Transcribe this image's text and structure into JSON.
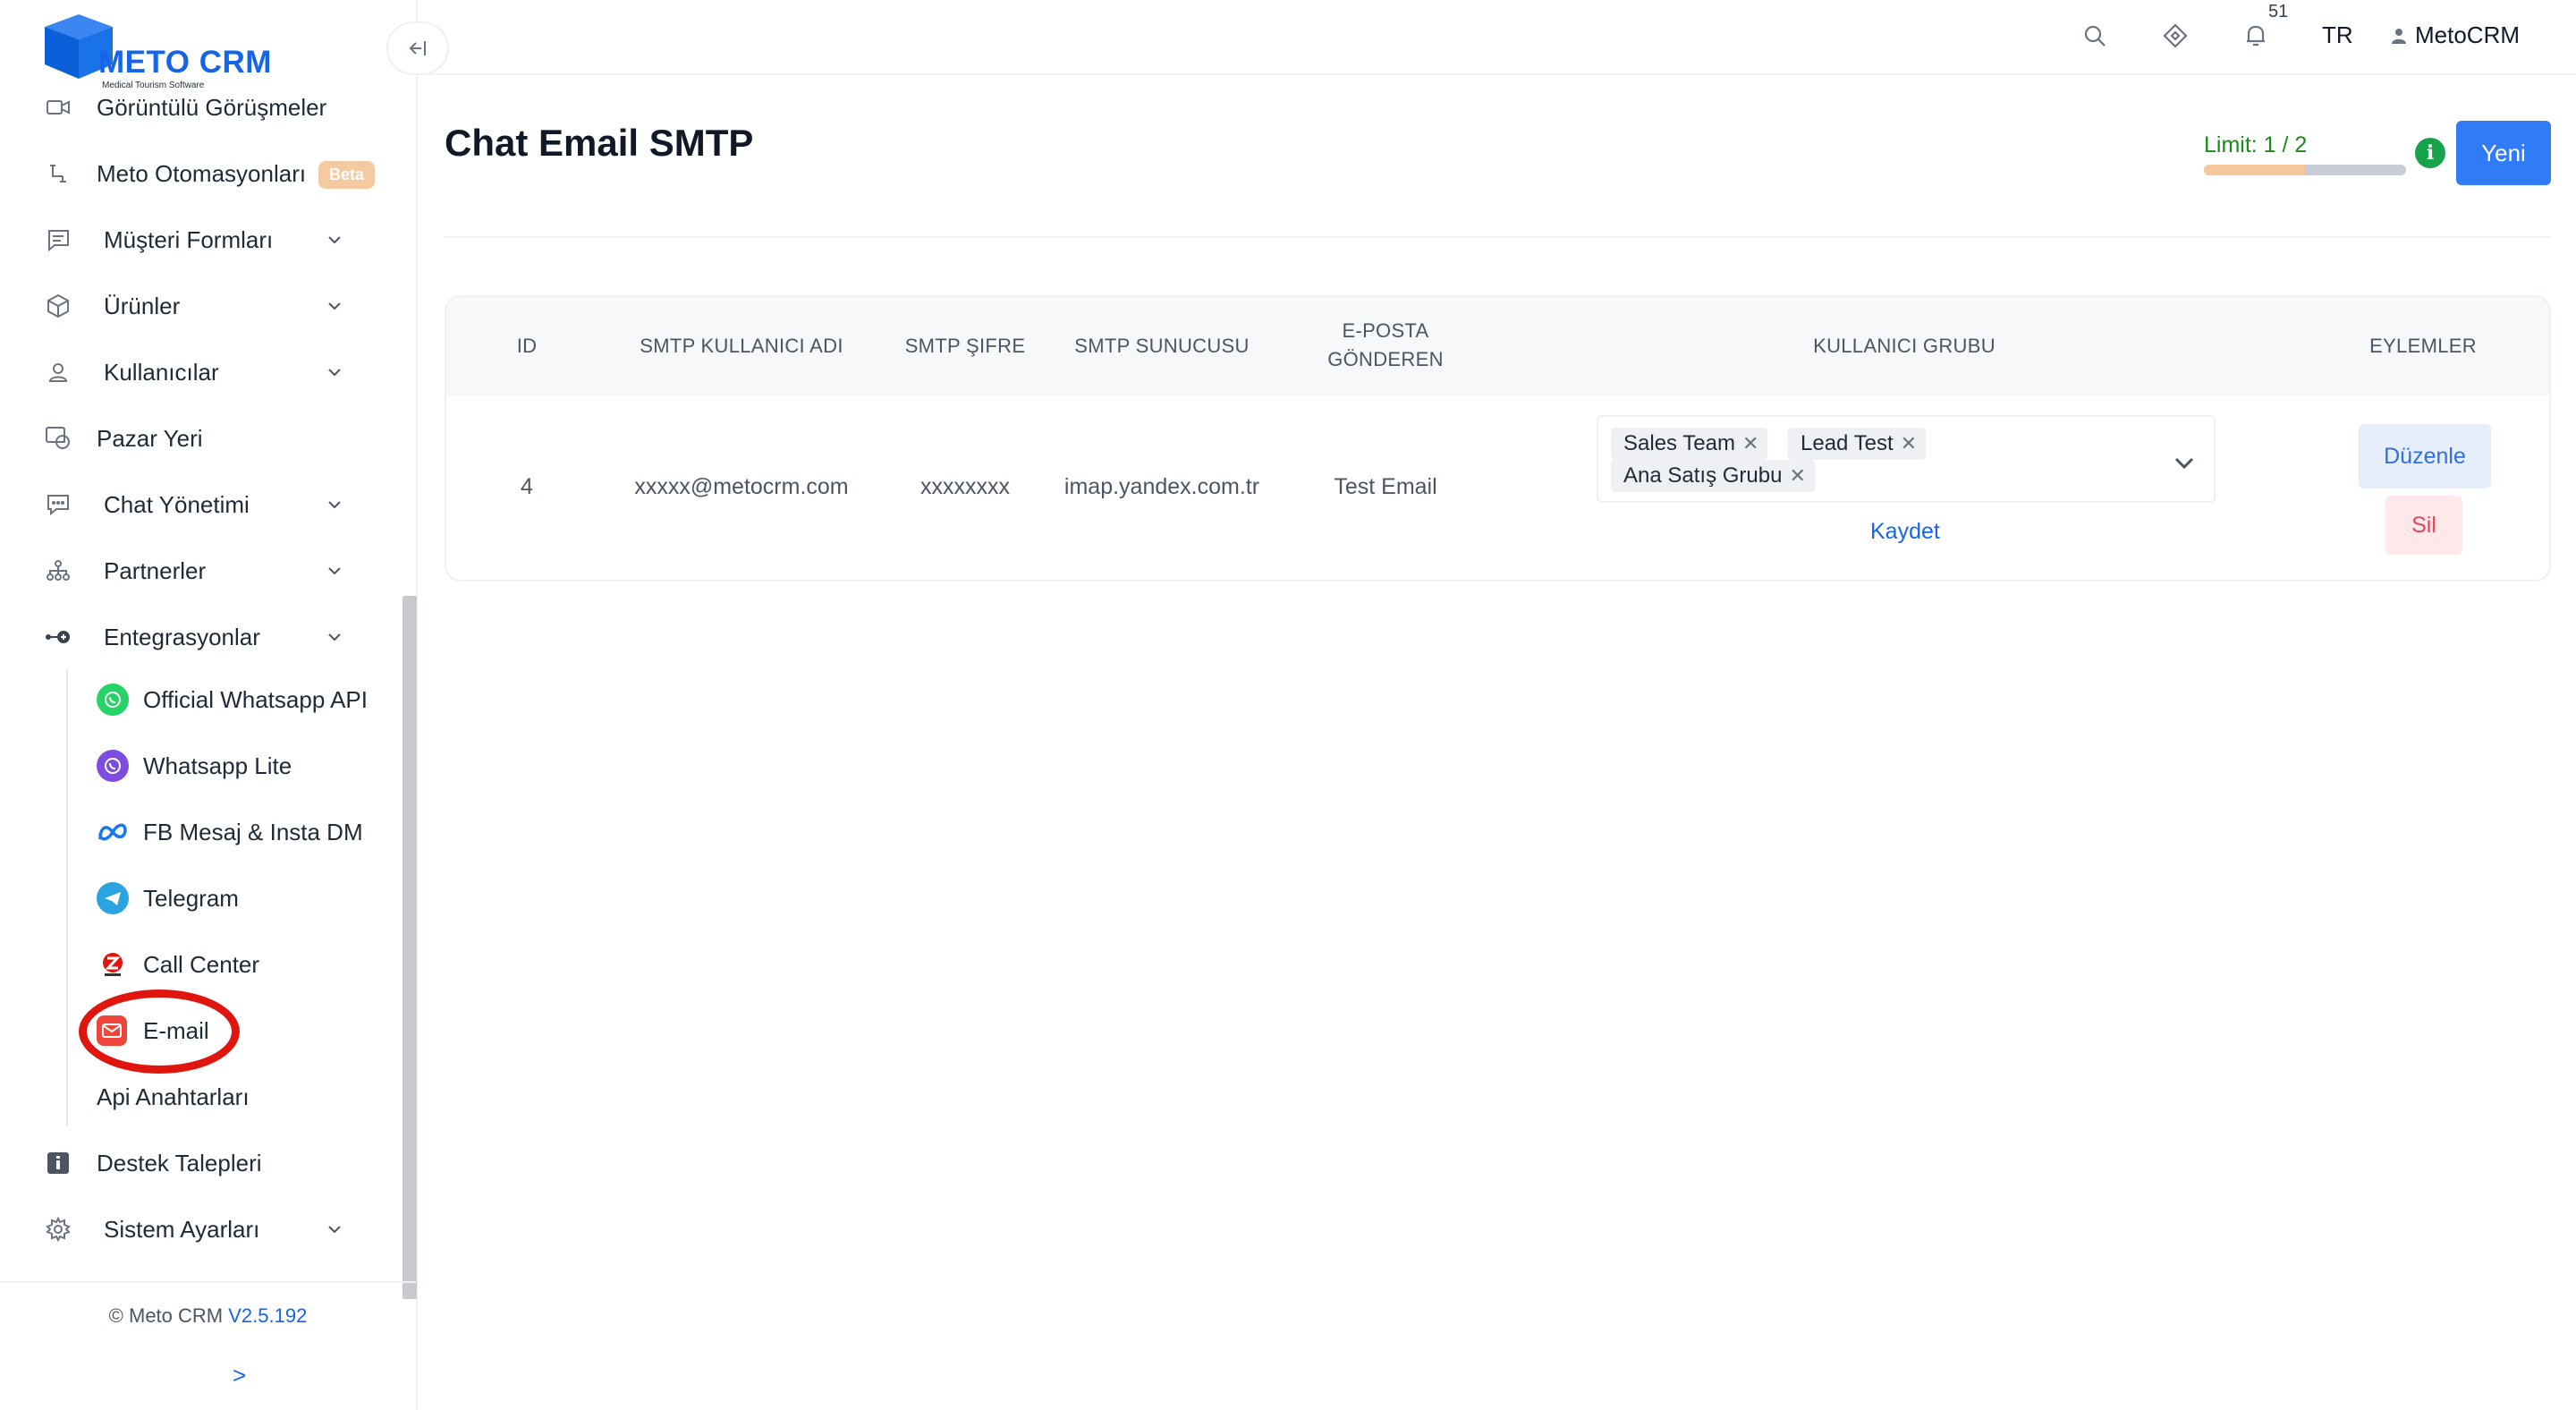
{
  "brand": {
    "name": "METO CRM",
    "tagline": "Medical Tourism Software",
    "color": "#1565e8"
  },
  "sidebar": {
    "collapse_icon": "collapse-left-icon",
    "items": [
      {
        "label": "Görüntülü Görüşmeler",
        "icon": "video-icon"
      },
      {
        "label": "Meto Otomasyonları",
        "icon": "automation-icon",
        "badge": "Beta"
      },
      {
        "label": "Müşteri Formları",
        "icon": "form-icon",
        "expandable": true
      },
      {
        "label": "Ürünler",
        "icon": "box-icon",
        "expandable": true
      },
      {
        "label": "Kullanıcılar",
        "icon": "user-icon",
        "expandable": true
      },
      {
        "label": "Pazar Yeri",
        "icon": "marketplace-icon"
      },
      {
        "label": "Chat Yönetimi",
        "icon": "chat-icon",
        "expandable": true
      },
      {
        "label": "Partnerler",
        "icon": "partners-icon",
        "expandable": true
      },
      {
        "label": "Entegrasyonlar",
        "icon": "integration-icon",
        "expandable": true,
        "expanded": true
      }
    ],
    "integrations": [
      {
        "label": "Official Whatsapp API",
        "icon": "whatsapp-icon"
      },
      {
        "label": "Whatsapp Lite",
        "icon": "viber-icon"
      },
      {
        "label": "FB Mesaj & Insta DM",
        "icon": "meta-icon"
      },
      {
        "label": "Telegram",
        "icon": "telegram-icon"
      },
      {
        "label": "Call Center",
        "icon": "zadarma-icon"
      },
      {
        "label": "E-mail",
        "icon": "mail-icon",
        "highlighted": true
      },
      {
        "label": "Api Anahtarları"
      }
    ],
    "bottom_items": [
      {
        "label": "Destek Talepleri",
        "icon": "info-square-icon"
      },
      {
        "label": "Sistem Ayarları",
        "icon": "settings-icon",
        "expandable": true
      }
    ],
    "footer": {
      "copyright": "© Meto CRM",
      "version": "V2.5.192",
      "arrow": ">"
    }
  },
  "topbar": {
    "notification_count": "51",
    "language": "TR",
    "user": "MetoCRM"
  },
  "page": {
    "title": "Chat Email SMTP",
    "limit_label": "Limit: 1 / 2",
    "limit_fraction": 0.5,
    "new_button": "Yeni"
  },
  "table": {
    "headers": {
      "id": "ID",
      "user": "SMTP KULLANICI ADI",
      "password": "SMTP ŞIFRE",
      "server": "SMTP SUNUCUSU",
      "sender_1": "E-POSTA",
      "sender_2": "GÖNDEREN",
      "group": "KULLANICI GRUBU",
      "actions": "EYLEMLER"
    },
    "rows": [
      {
        "id": "4",
        "user": "xxxxx@metocrm.com",
        "password": "xxxxxxxx",
        "server": "imap.yandex.com.tr",
        "sender": "Test Email",
        "groups": [
          "Sales Team",
          "Lead Test",
          "Ana Satış Grubu"
        ],
        "save": "Kaydet",
        "edit": "Düzenle",
        "delete": "Sil"
      }
    ]
  },
  "colors": {
    "primary": "#2f7cf6",
    "limit_text": "#1a8a1a",
    "highlight_ring": "#e0160e",
    "danger": "#e0475a"
  }
}
